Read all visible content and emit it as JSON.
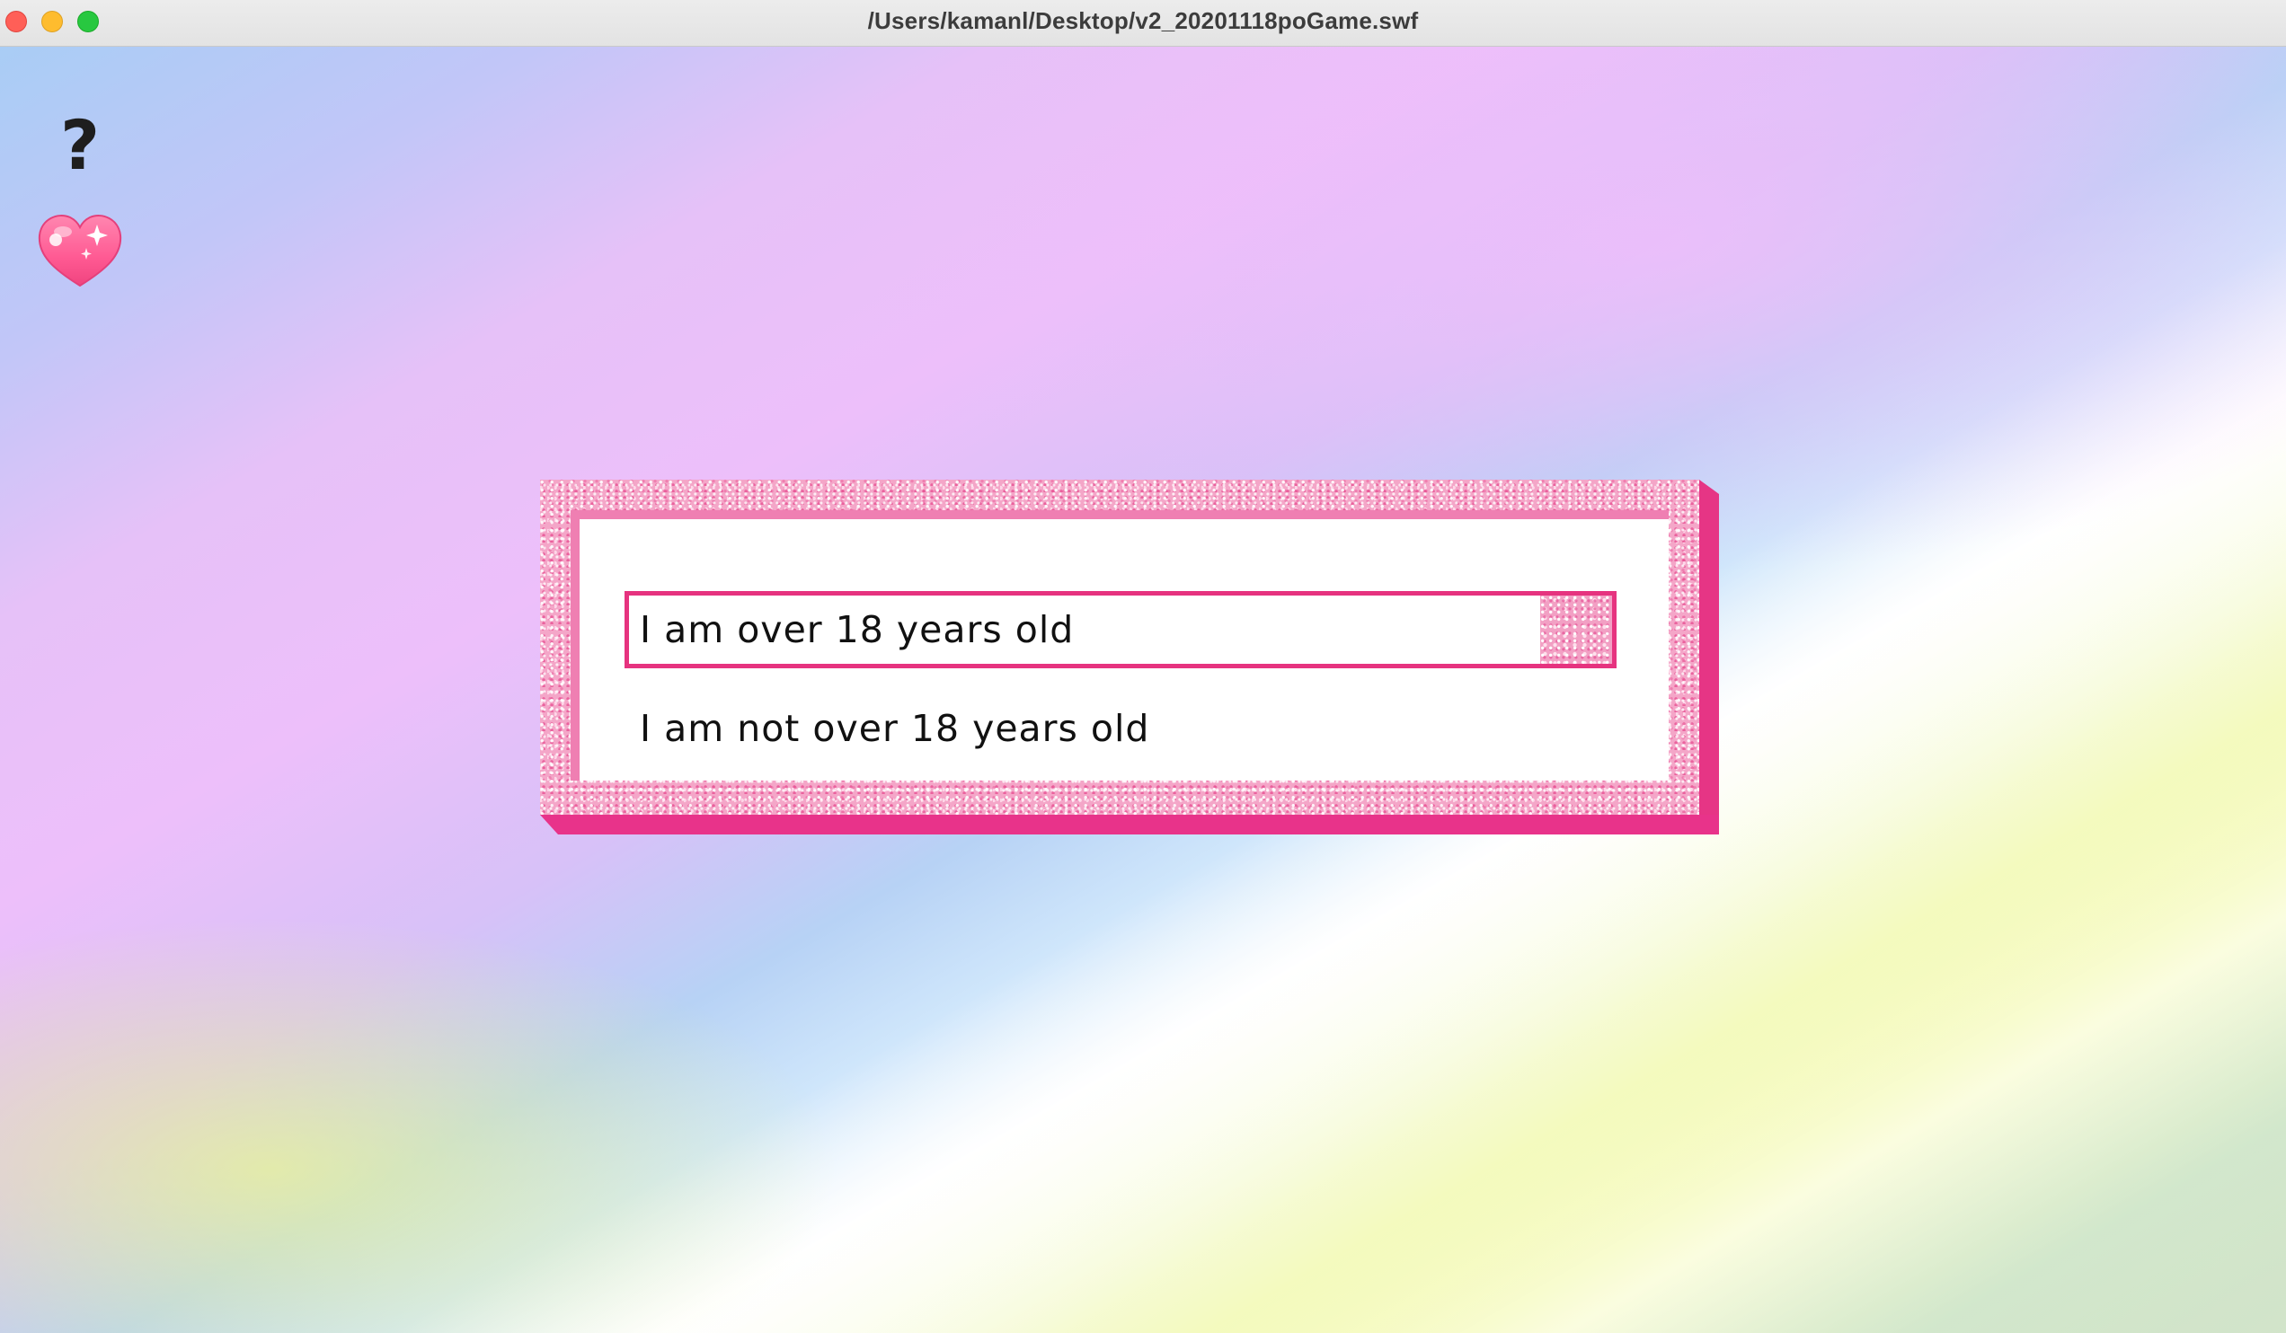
{
  "window": {
    "title": "/Users/kamanl/Desktop/v2_20201118poGame.swf",
    "controls": {
      "close": "close-button",
      "minimize": "minimize-button",
      "maximize": "zoom-button"
    }
  },
  "sidebar": {
    "help_glyph": "?",
    "help_icon": "question-mark-icon",
    "heart_icon": "sparkle-heart-icon"
  },
  "dialog": {
    "options": [
      {
        "label": "I am over 18 years old",
        "selected": true
      },
      {
        "label": "I am not over 18 years old",
        "selected": false
      }
    ]
  },
  "colors": {
    "accent": "#e6337f",
    "frame_glitter": "#f4a6c8",
    "frame_shadow": "#e8338a",
    "heart": "#ff5f94"
  }
}
